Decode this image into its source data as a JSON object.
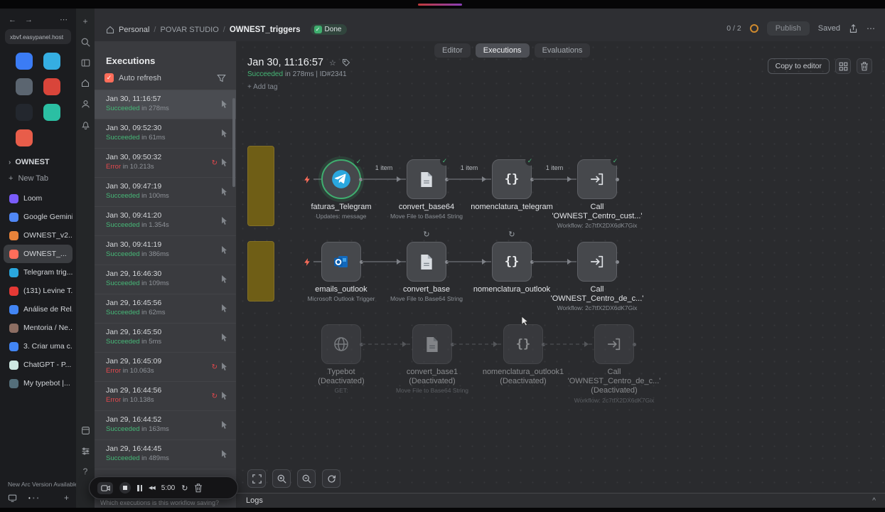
{
  "colors": {
    "success": "#46b877",
    "error": "#e5484d",
    "accent": "#ff6d5a",
    "sticky_note": "#6f5e16"
  },
  "browser": {
    "url": "xbvf.easypanel.host",
    "group_label": "OWNEST",
    "new_tab": "New Tab",
    "update_banner": "New Arc Version Available",
    "app_icons": [
      {
        "name": "pinned-app-1",
        "color": "#3b7cf5"
      },
      {
        "name": "pinned-app-2",
        "color": "#35aee2"
      },
      {
        "name": "pinned-app-3",
        "color": "#5b6570"
      },
      {
        "name": "pinned-app-4",
        "color": "#d9453a"
      },
      {
        "name": "pinned-app-5",
        "color": "#23272e"
      },
      {
        "name": "pinned-app-6",
        "color": "#2bbfa3"
      },
      {
        "name": "pinned-app-7",
        "color": "#e85d4a"
      }
    ],
    "tabs": [
      {
        "label": "Loom",
        "color": "#7a5cfa"
      },
      {
        "label": "Google Gemini",
        "color": "#5087f5"
      },
      {
        "label": "OWNEST_v2...",
        "color": "#e8833a"
      },
      {
        "label": "OWNEST_...",
        "color": "#ff6d5a",
        "active": true
      },
      {
        "label": "Telegram trig...",
        "color": "#2aa7de"
      },
      {
        "label": "(131) Levine T...",
        "color": "#e53935"
      },
      {
        "label": "Análise de Rel...",
        "color": "#4285f4"
      },
      {
        "label": "Mentoria / Ne...",
        "color": "#8d6e63"
      },
      {
        "label": "3. Criar uma c...",
        "color": "#4285f4"
      },
      {
        "label": "ChatGPT - P...",
        "color": "#cfe9e3"
      },
      {
        "label": "My typebot |...",
        "color": "#546e7a"
      }
    ]
  },
  "rail": {
    "top": [
      "plus",
      "search",
      "panel",
      "home",
      "user",
      "bell"
    ],
    "bottom": [
      "box",
      "sliders",
      "help"
    ]
  },
  "header": {
    "breadcrumb": {
      "root": "Personal",
      "project": "POVAR STUDIO",
      "workflow": "OWNEST_triggers"
    },
    "done_badge": "Done",
    "counter": "0 / 2",
    "publish": "Publish",
    "saved": "Saved"
  },
  "view_tabs": {
    "items": [
      {
        "label": "Editor"
      },
      {
        "label": "Executions",
        "active": true
      },
      {
        "label": "Evaluations"
      }
    ]
  },
  "executions": {
    "title": "Executions",
    "auto_refresh": "Auto refresh",
    "items": [
      {
        "date": "Jan 30, 11:16:57",
        "status": "Succeeded",
        "detail": "in 278ms",
        "selected": true
      },
      {
        "date": "Jan 30, 09:52:30",
        "status": "Succeeded",
        "detail": "in 61ms"
      },
      {
        "date": "Jan 30, 09:50:32",
        "status": "Error",
        "detail": "in 10.213s",
        "error": true
      },
      {
        "date": "Jan 30, 09:47:19",
        "status": "Succeeded",
        "detail": "in 100ms"
      },
      {
        "date": "Jan 30, 09:41:20",
        "status": "Succeeded",
        "detail": "in 1.354s"
      },
      {
        "date": "Jan 30, 09:41:19",
        "status": "Succeeded",
        "detail": "in 386ms"
      },
      {
        "date": "Jan 29, 16:46:30",
        "status": "Succeeded",
        "detail": "in 109ms"
      },
      {
        "date": "Jan 29, 16:45:56",
        "status": "Succeeded",
        "detail": "in 62ms"
      },
      {
        "date": "Jan 29, 16:45:50",
        "status": "Succeeded",
        "detail": "in 5ms"
      },
      {
        "date": "Jan 29, 16:45:09",
        "status": "Error",
        "detail": "in 10.063s",
        "error": true
      },
      {
        "date": "Jan 29, 16:44:56",
        "status": "Error",
        "detail": "in 10.138s",
        "error": true
      },
      {
        "date": "Jan 29, 16:44:52",
        "status": "Succeeded",
        "detail": "in 163ms"
      },
      {
        "date": "Jan 29, 16:44:45",
        "status": "Succeeded",
        "detail": "in 489ms"
      }
    ]
  },
  "detail": {
    "title": "Jan 30, 11:16:57",
    "status": "Succeeded",
    "meta": "in 278ms | ID#2341",
    "add_tag": "+ Add tag",
    "copy_to_editor": "Copy to editor"
  },
  "workflow": {
    "rows": [
      {
        "trigger": true,
        "connections": [
          "1 item",
          "1 item",
          "1 item"
        ],
        "nodes": [
          {
            "icon": "telegram",
            "shape": "circle",
            "selected": true,
            "check": true,
            "lines": [
              "faturas_Telegram"
            ],
            "subs": [
              "Updates: message"
            ]
          },
          {
            "icon": "file",
            "check": true,
            "lines": [
              "convert_base64"
            ],
            "subs": [
              "Move File to Base64 String"
            ]
          },
          {
            "icon": "braces",
            "check": true,
            "lines": [
              "nomenclatura_telegram"
            ],
            "subs": []
          },
          {
            "icon": "call",
            "check": true,
            "lines": [
              "Call",
              "'OWNEST_Centro_cust...'"
            ],
            "subs": [
              "Workflow: 2c7tfX2DX6dK7Gix"
            ]
          }
        ]
      },
      {
        "trigger": true,
        "connections": [
          "",
          "",
          ""
        ],
        "nodes": [
          {
            "icon": "outlook",
            "lines": [
              "emails_outlook"
            ],
            "subs": [
              "Microsoft Outlook Trigger"
            ]
          },
          {
            "icon": "file",
            "badge": true,
            "lines": [
              "convert_base"
            ],
            "subs": [
              "Move File to Base64 String"
            ]
          },
          {
            "icon": "braces",
            "badge": true,
            "lines": [
              "nomenclatura_outlook"
            ],
            "subs": []
          },
          {
            "icon": "call",
            "lines": [
              "Call",
              "'OWNEST_Centro_de_c...'"
            ],
            "subs": [
              "Workflow: 2c7tfX2DX6dK7Gix"
            ]
          }
        ]
      },
      {
        "deactivated": true,
        "connections": [
          "",
          "",
          ""
        ],
        "nodes": [
          {
            "icon": "globe",
            "lines": [
              "Typebot",
              "(Deactivated)"
            ],
            "subs": [
              "GET:"
            ]
          },
          {
            "icon": "file",
            "lines": [
              "convert_base1",
              "(Deactivated)"
            ],
            "subs": [
              "Move File to Base64 String"
            ]
          },
          {
            "icon": "braces",
            "lines": [
              "nomenclatura_outlook1",
              "(Deactivated)"
            ],
            "subs": []
          },
          {
            "icon": "call",
            "lines": [
              "Call",
              "'OWNEST_Centro_de_c...'",
              "(Deactivated)"
            ],
            "subs": [
              "Workflow: 2c7tfX2DX6dK7Gix"
            ]
          }
        ]
      }
    ]
  },
  "logs": {
    "label": "Logs"
  },
  "recorder": {
    "time": "5:00"
  },
  "caption": "Which executions is this workflow saving?"
}
